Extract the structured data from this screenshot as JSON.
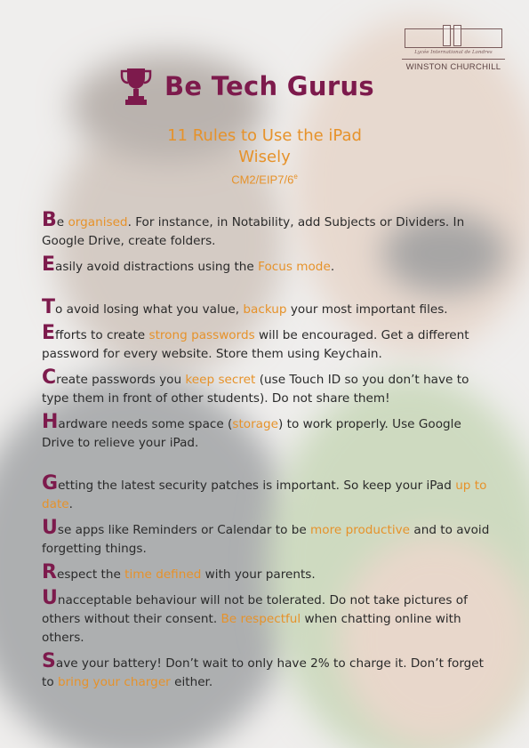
{
  "logo": {
    "tagline": "Lycée International de Londres",
    "name": "WINSTON CHURCHILL"
  },
  "header": {
    "title": "Be Tech Gurus",
    "subtitle_line1": "11 Rules to Use the iPad",
    "subtitle_line2": "Wisely",
    "level": "CM2/EIP7/6",
    "level_sup": "e"
  },
  "rules": [
    {
      "cap": "B",
      "a": "e ",
      "hl": "organised",
      "b": ". For instance, in Notability, add Subjects or Dividers. In Google Drive, create folders."
    },
    {
      "cap": "E",
      "a": "asily avoid distractions using the ",
      "hl": "Focus mode",
      "b": "."
    },
    {
      "cap": "T",
      "a": "o avoid losing what you value, ",
      "hl": "backup",
      "b": " your most important files."
    },
    {
      "cap": "E",
      "a": "fforts to create ",
      "hl": "strong passwords",
      "b": " will be encouraged. Get a different password for every website. Store them using Keychain."
    },
    {
      "cap": "C",
      "a": "reate passwords you ",
      "hl": "keep secret",
      "b": " (use Touch ID so you don’t have to type them in front of other students). Do not share them!"
    },
    {
      "cap": "H",
      "a": "ardware needs some space (",
      "hl": "storage",
      "b": ") to work properly. Use Google Drive to relieve your iPad."
    },
    {
      "cap": "G",
      "a": "etting the latest security patches is important. So keep your iPad ",
      "hl": "up to date",
      "b": "."
    },
    {
      "cap": "U",
      "a": "se apps like Reminders or Calendar to be ",
      "hl": "more productive",
      "b": " and to avoid forgetting things."
    },
    {
      "cap": "R",
      "a": "espect the ",
      "hl": "time defined",
      "b": " with your parents."
    },
    {
      "cap": "U",
      "a": "nacceptable behaviour will not be tolerated. Do not take pictures of others without their consent. ",
      "hl": "Be respectful",
      "b": " when chatting online with others."
    },
    {
      "cap": "S",
      "a": "ave your battery! Don’t wait to only have 2% to charge it. Don’t forget to ",
      "hl": "bring your charger",
      "b": " either."
    }
  ],
  "colors": {
    "brand": "#7d1a4c",
    "accent": "#e6922a",
    "text": "#2a2a2a"
  }
}
